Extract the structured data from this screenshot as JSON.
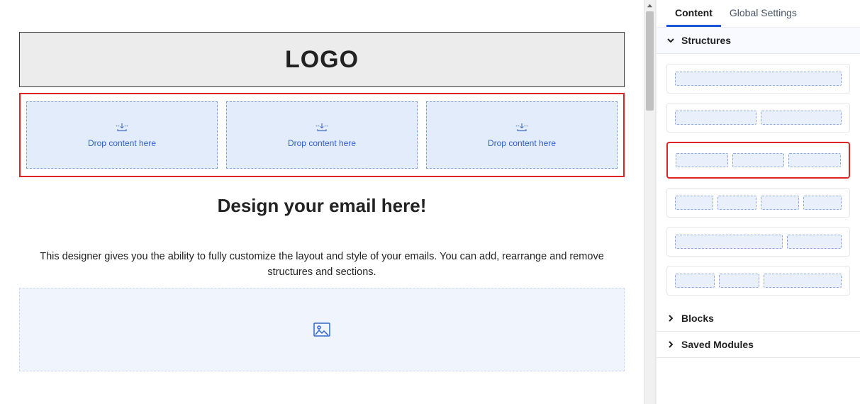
{
  "canvas": {
    "logo_text": "LOGO",
    "dropzone_label_1": "Drop content here",
    "dropzone_label_2": "Drop content here",
    "dropzone_label_3": "Drop content here",
    "heading": "Design your email here!",
    "body_text": "This designer gives you the ability to fully customize the layout and style of your emails. You can add, rearrange and remove structures and sections."
  },
  "panel": {
    "tabs": {
      "content": "Content",
      "global": "Global Settings"
    },
    "sections": {
      "structures": "Structures",
      "blocks": "Blocks",
      "saved_modules": "Saved Modules"
    },
    "structures": [
      {
        "cols": [
          1
        ]
      },
      {
        "cols": [
          1,
          1
        ]
      },
      {
        "cols": [
          1,
          1,
          1
        ],
        "selected": true
      },
      {
        "cols": [
          1,
          1,
          1,
          1
        ]
      },
      {
        "cols": [
          2,
          1
        ]
      },
      {
        "cols": [
          1,
          1,
          2
        ]
      }
    ]
  },
  "icons": {
    "drop": "drop-icon",
    "image": "image-icon"
  }
}
